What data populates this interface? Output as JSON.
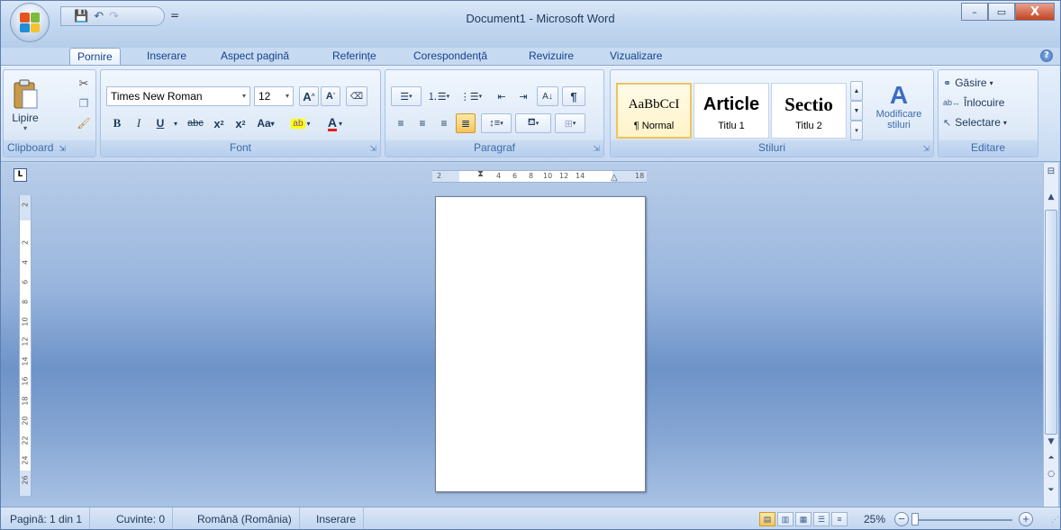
{
  "window": {
    "title": "Document1 - Microsoft Word",
    "controls": {
      "minimize": "–",
      "maximize": "▭",
      "close": "X"
    }
  },
  "quick_access": {
    "save_icon": "save-icon",
    "undo_icon": "undo-icon",
    "redo_icon": "redo-icon",
    "dropdown": "="
  },
  "tabs": [
    "Pornire",
    "Inserare",
    "Aspect pagină",
    "Referințe",
    "Corespondență",
    "Revizuire",
    "Vizualizare"
  ],
  "active_tab": "Pornire",
  "ribbon": {
    "clipboard": {
      "label": "Clipboard",
      "paste": "Lipire"
    },
    "font": {
      "label": "Font",
      "family": "Times New Roman",
      "size": "12",
      "grow": "A",
      "shrink": "A",
      "bold": "B",
      "italic": "I",
      "underline": "U",
      "strike": "abc",
      "subscript": "x",
      "superscript": "x",
      "change_case": "Aa",
      "font_color": "A"
    },
    "paragraph": {
      "label": "Paragraf"
    },
    "styles": {
      "label": "Stiluri",
      "items": [
        {
          "sample": "AaBbCcI",
          "name": "¶ Normal"
        },
        {
          "sample": "Article",
          "name": "Titlu 1"
        },
        {
          "sample": "Sectio",
          "name": "Titlu 2"
        }
      ],
      "change": "Modificare stiluri"
    },
    "editing": {
      "label": "Editare",
      "find": "Găsire",
      "replace": "Înlocuire",
      "select": "Selectare"
    }
  },
  "ruler": {
    "horizontal": [
      "2",
      "2",
      "4",
      "6",
      "8",
      "10",
      "12",
      "14",
      "18"
    ],
    "vertical": [
      "2",
      "2",
      "4",
      "6",
      "8",
      "10",
      "12",
      "14",
      "16",
      "18",
      "20",
      "22",
      "24",
      "26"
    ]
  },
  "status": {
    "page": "Pagină: 1 din 1",
    "words": "Cuvinte: 0",
    "language": "Română (România)",
    "mode": "Inserare",
    "zoom": "25%",
    "zoom_fraction": 0.0
  },
  "colors": {
    "accent": "#15428b",
    "ribbon": "#dfeaf8",
    "workspace": "#9ab6de"
  }
}
